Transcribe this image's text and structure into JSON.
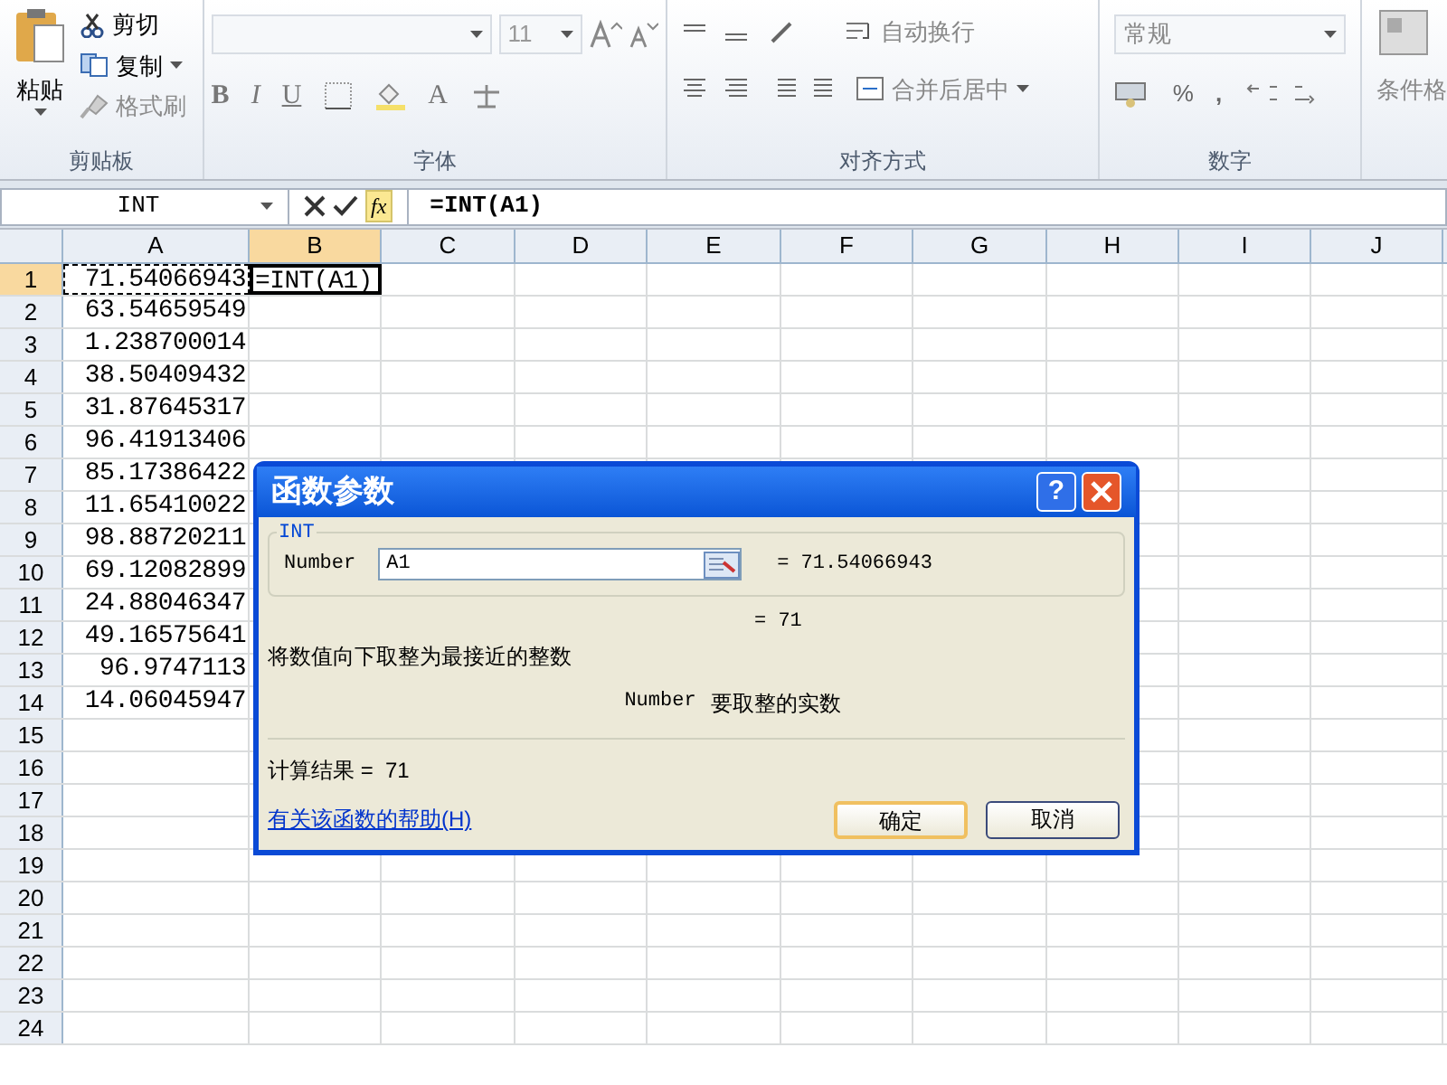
{
  "ribbon": {
    "clipboard": {
      "paste": "粘贴",
      "cut": "剪切",
      "copy": "复制",
      "format_painter": "格式刷",
      "label": "剪贴板"
    },
    "font": {
      "font_size": "11",
      "bold": "B",
      "italic": "I",
      "underline": "U",
      "font_color": "A",
      "label": "字体"
    },
    "alignment": {
      "wrap_text": "自动换行",
      "merge_center": "合并后居中",
      "label": "对齐方式"
    },
    "number": {
      "format": "常规",
      "percent": "%",
      "comma": ",",
      "label": "数字"
    },
    "styles": {
      "conditional_format": "条件格"
    }
  },
  "formula_bar": {
    "name_box": "INT",
    "fx": "fx",
    "formula": "=INT(A1)"
  },
  "sheet": {
    "columns": [
      {
        "label": "A",
        "selected": false
      },
      {
        "label": "B",
        "selected": true
      },
      {
        "label": "C",
        "selected": false
      },
      {
        "label": "D",
        "selected": false
      },
      {
        "label": "E",
        "selected": false
      },
      {
        "label": "F",
        "selected": false
      },
      {
        "label": "G",
        "selected": false
      },
      {
        "label": "H",
        "selected": false
      },
      {
        "label": "I",
        "selected": false
      },
      {
        "label": "J",
        "selected": false
      }
    ],
    "rows": [
      {
        "header": "1",
        "selected": true,
        "cells": [
          {
            "text": "71.54066943",
            "referenced": true
          },
          {
            "text": "=INT(A1)",
            "editing": true
          }
        ]
      },
      {
        "header": "2",
        "selected": false,
        "cells": [
          {
            "text": "63.54659549"
          }
        ]
      },
      {
        "header": "3",
        "selected": false,
        "cells": [
          {
            "text": "1.238700014"
          }
        ]
      },
      {
        "header": "4",
        "selected": false,
        "cells": [
          {
            "text": "38.50409432"
          }
        ]
      },
      {
        "header": "5",
        "selected": false,
        "cells": [
          {
            "text": "31.87645317"
          }
        ]
      },
      {
        "header": "6",
        "selected": false,
        "cells": [
          {
            "text": "96.41913406"
          }
        ]
      },
      {
        "header": "7",
        "selected": false,
        "cells": [
          {
            "text": "85.17386422"
          }
        ]
      },
      {
        "header": "8",
        "selected": false,
        "cells": [
          {
            "text": "11.65410022"
          }
        ]
      },
      {
        "header": "9",
        "selected": false,
        "cells": [
          {
            "text": "98.88720211"
          }
        ]
      },
      {
        "header": "10",
        "selected": false,
        "cells": [
          {
            "text": "69.12082899"
          }
        ]
      },
      {
        "header": "11",
        "selected": false,
        "cells": [
          {
            "text": "24.88046347"
          }
        ]
      },
      {
        "header": "12",
        "selected": false,
        "cells": [
          {
            "text": "49.16575641"
          }
        ]
      },
      {
        "header": "13",
        "selected": false,
        "cells": [
          {
            "text": "96.9747113"
          }
        ]
      },
      {
        "header": "14",
        "selected": false,
        "cells": [
          {
            "text": "14.06045947"
          }
        ]
      },
      {
        "header": "15",
        "selected": false,
        "cells": []
      },
      {
        "header": "16",
        "selected": false,
        "cells": []
      },
      {
        "header": "17",
        "selected": false,
        "cells": []
      },
      {
        "header": "18",
        "selected": false,
        "cells": []
      },
      {
        "header": "19",
        "selected": false,
        "cells": []
      },
      {
        "header": "20",
        "selected": false,
        "cells": []
      },
      {
        "header": "21",
        "selected": false,
        "cells": []
      },
      {
        "header": "22",
        "selected": false,
        "cells": []
      },
      {
        "header": "23",
        "selected": false,
        "cells": []
      },
      {
        "header": "24",
        "selected": false,
        "cells": []
      }
    ]
  },
  "dialog": {
    "title": "函数参数",
    "help": "?",
    "function_name": "INT",
    "argument": {
      "label": "Number",
      "value": "A1",
      "result": "= 71.54066943"
    },
    "function_result": "= 71",
    "description": "将数值向下取整为最接近的整数",
    "argument_help": {
      "name": "Number",
      "text": "要取整的实数"
    },
    "calculation": "计算结果 =  71",
    "help_link": "有关该函数的帮助(H)",
    "ok": "确定",
    "cancel": "取消"
  }
}
